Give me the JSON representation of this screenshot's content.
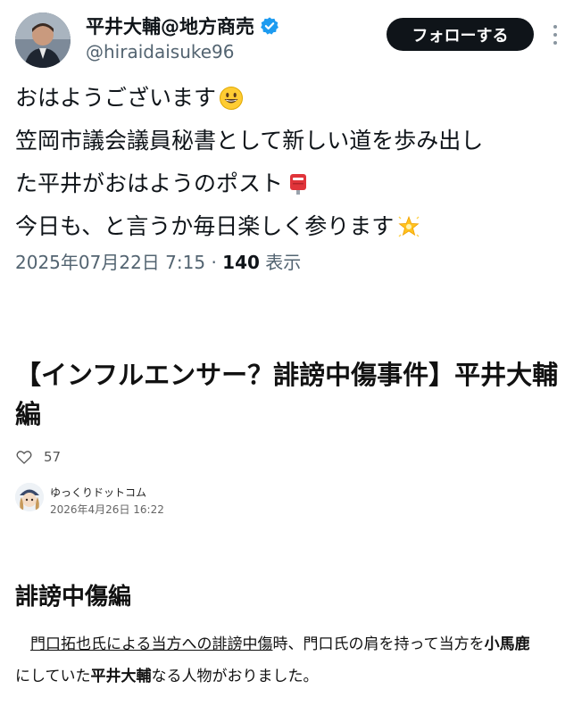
{
  "tweet": {
    "user_name": "平井大輔@地方商売",
    "user_handle": "@hiraidaisuke96",
    "follow_label": "フォローする",
    "text_lines": [
      "おはようございます",
      "笠岡市議会議員秘書として新しい道を歩み出し",
      "た平井がおはようのポスト",
      "今日も、と言うか毎日楽しく参ります"
    ],
    "date": "2025年07月22日 7:15",
    "separator": "·",
    "views_count": "140",
    "views_label": "表示",
    "icons": [
      "avatar",
      "verified-badge-icon",
      "more-options-icon",
      "grinning-face-emoji",
      "postbox-emoji",
      "glowing-star-emoji"
    ],
    "colors": {
      "verified": "#1d9bf0",
      "follow_bg": "#0f1419",
      "meta": "#536471"
    }
  },
  "article": {
    "title": "【インフルエンサー？誹謗中傷事件】平井大輔編",
    "likes_count": "57",
    "author_name": "ゆっくりドットコム",
    "author_date": "2026年4月26日 16:22",
    "section_heading": "誹謗中傷編",
    "body": {
      "part1": "門口拓也氏による当方への誹謗中傷",
      "part2": "時、門口氏の肩を持って当方を",
      "part3": "小馬鹿",
      "part4": "にしていた",
      "part5": "平井大輔",
      "part6": "なる人物がおりました。"
    },
    "icons": [
      "heart-icon",
      "author-avatar"
    ]
  }
}
